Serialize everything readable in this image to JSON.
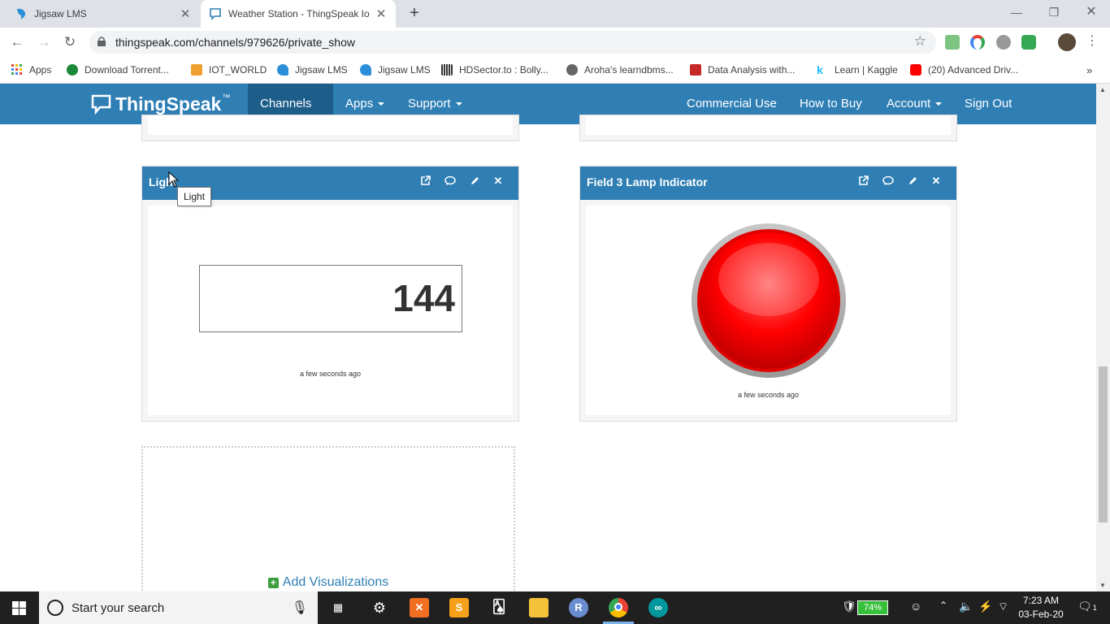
{
  "browser": {
    "tabs": [
      {
        "title": "Jigsaw LMS",
        "active": false
      },
      {
        "title": "Weather Station - ThingSpeak Io",
        "active": true
      }
    ],
    "url": "thingspeak.com/channels/979626/private_show",
    "bookmarks": [
      {
        "label": "Apps",
        "icon": "apps-grid-icon"
      },
      {
        "label": "Download Torrent...",
        "icon": "utorrent-icon"
      },
      {
        "label": "IOT_WORLD",
        "icon": "folder-icon"
      },
      {
        "label": "Jigsaw LMS",
        "icon": "jigsaw-icon"
      },
      {
        "label": "Jigsaw LMS",
        "icon": "jigsaw-icon"
      },
      {
        "label": "HDSector.to : Bolly...",
        "icon": "hdsector-icon"
      },
      {
        "label": "Aroha's learndbms...",
        "icon": "globe-icon"
      },
      {
        "label": "Data Analysis with...",
        "icon": "pd-icon"
      },
      {
        "label": "Learn | Kaggle",
        "icon": "kaggle-icon"
      },
      {
        "label": "(20) Advanced Driv...",
        "icon": "youtube-icon"
      }
    ]
  },
  "nav": {
    "logo": "ThingSpeak",
    "logo_tm": "™",
    "channels": "Channels",
    "apps": "Apps",
    "support": "Support",
    "commercial": "Commercial Use",
    "how_to_buy": "How to Buy",
    "account": "Account",
    "sign_out": "Sign Out"
  },
  "widgets": {
    "light": {
      "title": "Light",
      "value": "144",
      "updated": "a few seconds ago",
      "tooltip": "Light"
    },
    "lamp": {
      "title": "Field 3 Lamp Indicator",
      "state": "off",
      "color": "#ff0000",
      "updated": "a few seconds ago"
    }
  },
  "add_visualizations": "Add Visualizations",
  "taskbar": {
    "search_placeholder": "Start your search",
    "battery": "74%",
    "time": "7:23 AM",
    "date": "03-Feb-20",
    "notifications": "1"
  }
}
